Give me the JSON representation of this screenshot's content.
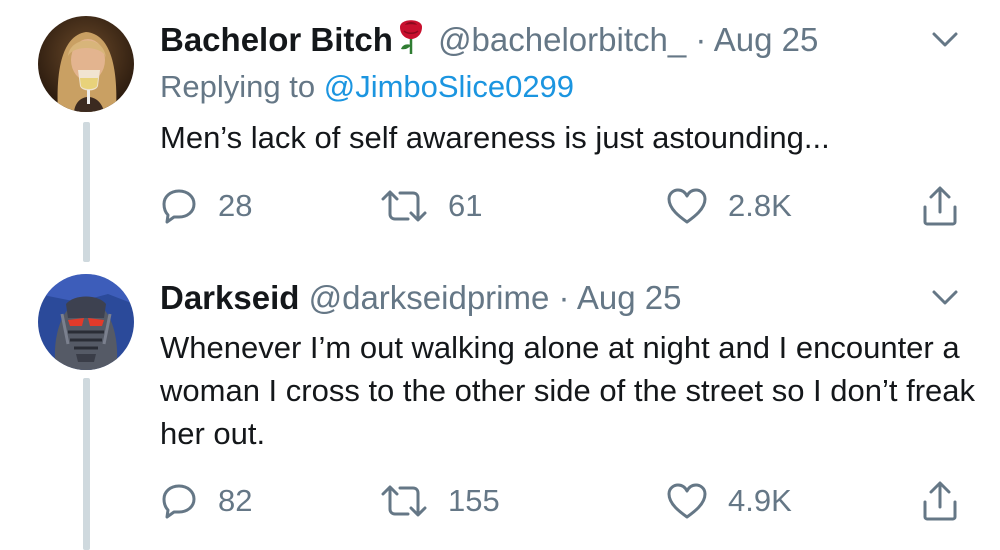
{
  "tweets": [
    {
      "name": "Bachelor Bitch",
      "handle": "@bachelorbitch_",
      "separator": "·",
      "date": "Aug 25",
      "replying_prefix": "Replying to",
      "replying_handle": "@JimboSlice0299",
      "text": "Men’s lack of self awareness is just astounding...",
      "replies": "28",
      "retweets": "61",
      "likes": "2.8K",
      "avatar": "woman-with-wine-glass"
    },
    {
      "name": "Darkseid",
      "handle": "@darkseidprime",
      "separator": "·",
      "date": "Aug 25",
      "text": "Whenever I’m out walking alone at night and I encounter a woman I cross to the other side of the street so I don’t freak her out.",
      "replies": "82",
      "retweets": "155",
      "likes": "4.9K",
      "avatar": "darkseid-comic-face"
    }
  ],
  "icons": {
    "reply": "reply-icon",
    "retweet": "retweet-icon",
    "like": "heart-icon",
    "share": "share-icon",
    "menu": "chevron-down-icon",
    "emoji": "rose-icon"
  },
  "colors": {
    "text": "#14171a",
    "secondary": "#657786",
    "link": "#1b95e0",
    "thread_line": "#cfd9de",
    "rose": "#c8102e"
  }
}
